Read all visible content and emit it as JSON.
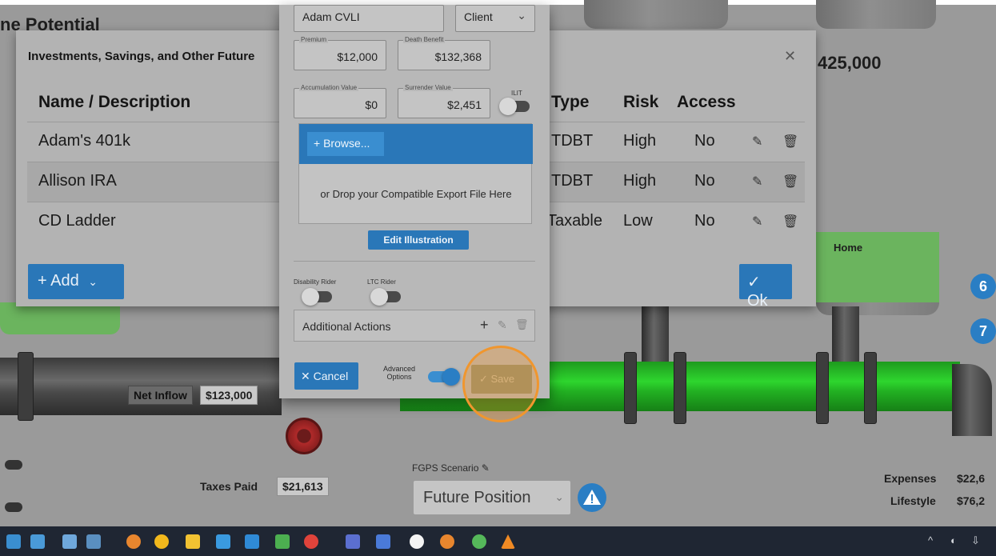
{
  "background": {
    "title_fragment": "ne Potential",
    "top_right_value": "425,000",
    "home_label": "Home",
    "net_inflow_label": "Net Inflow",
    "net_inflow_value": "$123,000",
    "taxes_paid_label": "Taxes Paid",
    "taxes_paid_value": "$21,613",
    "fgps_label": "FGPS Scenario",
    "scenario_value": "Future Position",
    "expenses_label": "Expenses",
    "expenses_value": "$22,6",
    "lifestyle_label": "Lifestyle",
    "lifestyle_value": "$76,2",
    "badge_6": "6",
    "badge_7": "7"
  },
  "investments_modal": {
    "title": "Investments, Savings, and Other Future",
    "close_icon": "close-icon",
    "columns": [
      "Name / Description",
      "Type",
      "Risk",
      "Access"
    ],
    "rows": [
      {
        "name": "Adam's 401k",
        "type": "TDBT",
        "risk": "High",
        "access": "No"
      },
      {
        "name": "Allison IRA",
        "type": "TDBT",
        "risk": "High",
        "access": "No"
      },
      {
        "name": "CD Ladder",
        "type": "Taxable",
        "risk": "Low",
        "access": "No"
      }
    ],
    "add_label": "+ Add",
    "ok_label": "✓ Ok"
  },
  "policy_dialog": {
    "insured_value": "Adam CVLI",
    "owner_value": "Client",
    "premium_label": "Premium",
    "premium_value": "$12,000",
    "death_benefit_label": "Death Benefit",
    "death_benefit_value": "$132,368",
    "accumulation_label": "Accumulation Value",
    "accumulation_value": "$0",
    "surrender_label": "Surrender Value",
    "surrender_value": "$2,451",
    "ilit_label": "ILIT",
    "browse_label": "+ Browse...",
    "drop_text": "or Drop your Compatible Export File Here",
    "edit_label": "Edit Illustration",
    "disability_label": "Disability Rider",
    "ltc_label": "LTC Rider",
    "additional_actions": "Additional Actions",
    "cancel_label": "✕ Cancel",
    "advanced_label": "Advanced Options",
    "save_label": "✓ Save"
  },
  "colors": {
    "accent": "#2a77b8",
    "highlight": "#f0962e",
    "pipe_green": "#2ed62e"
  }
}
